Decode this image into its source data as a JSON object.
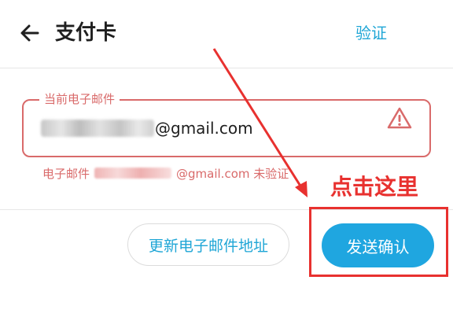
{
  "header": {
    "title": "支付卡",
    "verify_label": "验证"
  },
  "email_field": {
    "label": "当前电子邮件",
    "visible_value": "@gmail.com"
  },
  "helper": {
    "prefix": "电子邮件",
    "suffix": "@gmail.com 未验证"
  },
  "actions": {
    "update_email_label": "更新电子邮件地址",
    "send_confirm_label": "发送确认"
  },
  "annotation": {
    "text": "点击这里"
  },
  "colors": {
    "accent": "#1fa6d6",
    "error": "#d96a6a",
    "annotation_red": "#e8312f"
  },
  "icons": {
    "back": "arrow-left-icon",
    "warning": "warning-triangle-icon"
  }
}
